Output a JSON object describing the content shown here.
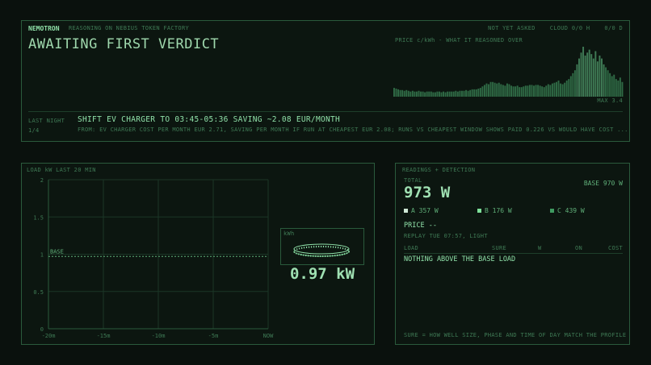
{
  "top": {
    "brand": "NEMOTRON",
    "subtitle": "REASONING ON NEBIUS TOKEN FACTORY",
    "status": [
      "NOT YET ASKED",
      "CLOUD 0/0 H",
      "0/0 D"
    ],
    "verdict_title": "AWAITING FIRST VERDICT",
    "price_label": "PRICE c/kWh  -  WHAT IT REASONED OVER",
    "max_label": "MAX 3.4",
    "last_night_label": "LAST NIGHT",
    "count": "1/4",
    "headline": "SHIFT EV CHARGER TO 03:45-05:36 SAVING ~2.08 EUR/MONTH",
    "detail": "FROM: EV CHARGER COST PER MONTH EUR 2.71, SAVING PER MONTH IF RUN AT CHEAPEST EUR 2.08; RUNS VS CHEAPEST WINDOW SHOWS PAID 0.226 VS WOULD HAVE COST ..."
  },
  "price_bars": {
    "max": 3.4,
    "values": [
      0.6,
      0.55,
      0.5,
      0.45,
      0.45,
      0.4,
      0.45,
      0.4,
      0.35,
      0.4,
      0.35,
      0.35,
      0.4,
      0.35,
      0.35,
      0.3,
      0.35,
      0.35,
      0.35,
      0.3,
      0.3,
      0.35,
      0.35,
      0.3,
      0.35,
      0.3,
      0.35,
      0.35,
      0.35,
      0.35,
      0.4,
      0.35,
      0.4,
      0.4,
      0.4,
      0.45,
      0.4,
      0.45,
      0.5,
      0.5,
      0.5,
      0.55,
      0.6,
      0.7,
      0.8,
      0.9,
      0.85,
      1.0,
      1.0,
      0.95,
      0.9,
      0.95,
      0.85,
      0.8,
      0.75,
      0.9,
      0.85,
      0.75,
      0.7,
      0.7,
      0.75,
      0.65,
      0.65,
      0.7,
      0.75,
      0.75,
      0.8,
      0.8,
      0.75,
      0.8,
      0.8,
      0.75,
      0.7,
      0.65,
      0.75,
      0.85,
      0.8,
      0.9,
      0.95,
      1.0,
      1.1,
      0.9,
      0.85,
      0.95,
      1.1,
      1.2,
      1.4,
      1.6,
      1.8,
      2.2,
      2.6,
      3.0,
      3.4,
      2.8,
      3.0,
      3.2,
      2.9,
      2.6,
      3.1,
      2.4,
      2.8,
      2.6,
      2.2,
      2.0,
      1.8,
      1.6,
      1.4,
      1.5,
      1.2,
      1.1,
      1.3,
      1.0
    ]
  },
  "load": {
    "title": "LOAD  kW  LAST 20 MIN",
    "y_ticks": [
      "2",
      "1.5",
      "1",
      "0.5",
      "0"
    ],
    "x_ticks": [
      "-20m",
      "-15m",
      "-10m",
      "-5m",
      "NOW"
    ],
    "base_label": "BASE",
    "base_value": 0.97,
    "meter_label": "kWh",
    "meter_value": "0.97 kW"
  },
  "chart_data": {
    "type": "line",
    "title": "LOAD  kW  LAST 20 MIN",
    "x": [
      "-20m",
      "-15m",
      "-10m",
      "-5m",
      "NOW"
    ],
    "ylim": [
      0,
      2
    ],
    "series": [
      {
        "name": "BASE",
        "values": [
          0.97,
          0.97,
          0.97,
          0.97,
          0.97
        ]
      }
    ],
    "grid": true
  },
  "readings": {
    "title": "READINGS  +  DETECTION",
    "total_label": "TOTAL",
    "total_value": "973 W",
    "base_value": "BASE 970 W",
    "phases": [
      {
        "label": "A 357 W",
        "color": "#cfe8d6"
      },
      {
        "label": "B 176 W",
        "color": "#7ee09a"
      },
      {
        "label": "C 439 W",
        "color": "#3f9a60"
      }
    ],
    "price_text": "PRICE --",
    "replay": "REPLAY TUE 07:57, LIGHT",
    "columns": [
      "LOAD",
      "SURE",
      "W",
      "ON",
      "COST"
    ],
    "empty_message": "NOTHING ABOVE THE BASE LOAD",
    "footnote": "SURE = HOW WELL SIZE, PHASE AND TIME OF DAY MATCH THE PROFILE"
  },
  "colors": {
    "accent": "#8fe0a8",
    "border": "#2a5a3c",
    "bar": "#2f6a45"
  }
}
